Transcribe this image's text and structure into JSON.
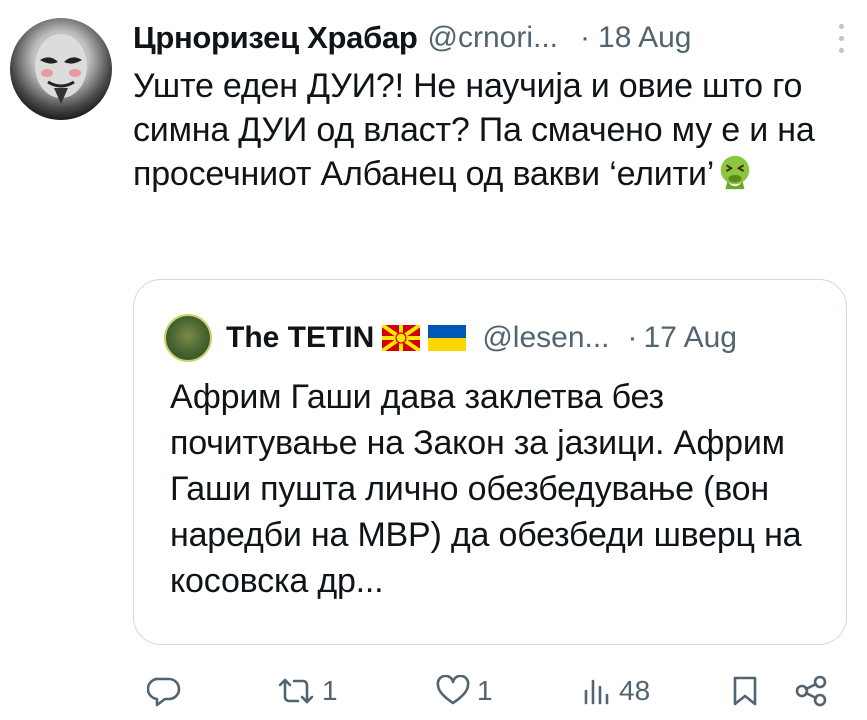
{
  "tweet": {
    "author_name": "Црноризец Храбар",
    "handle": "@crnori...",
    "separator": "·",
    "date": "18 Aug",
    "text": "Уште еден ДУИ?! Не научија и овие што го симна ДУИ од власт? Па смачено му е и на просечниот Албанец од вакви ‘елити’",
    "emoji_icon": "vomiting-face-emoji"
  },
  "quoted_tweet": {
    "author_name": "The TETIN",
    "flags": [
      "north-macedonia-flag-icon",
      "ukraine-flag-icon"
    ],
    "handle": "@lesen...",
    "separator": "·",
    "date": "17 Aug",
    "text": "Африм Гаши дава заклетва без почитување на Закон за јазици. Африм Гаши пушта лично обезбедување (вон наредби на МВР) да обезбеди шверц на косовска др..."
  },
  "actions": {
    "reply_count": "",
    "retweet_count": "1",
    "like_count": "1",
    "views_count": "48"
  },
  "colors": {
    "text": "#0f1419",
    "secondary": "#536471",
    "border": "#cfd9de"
  }
}
